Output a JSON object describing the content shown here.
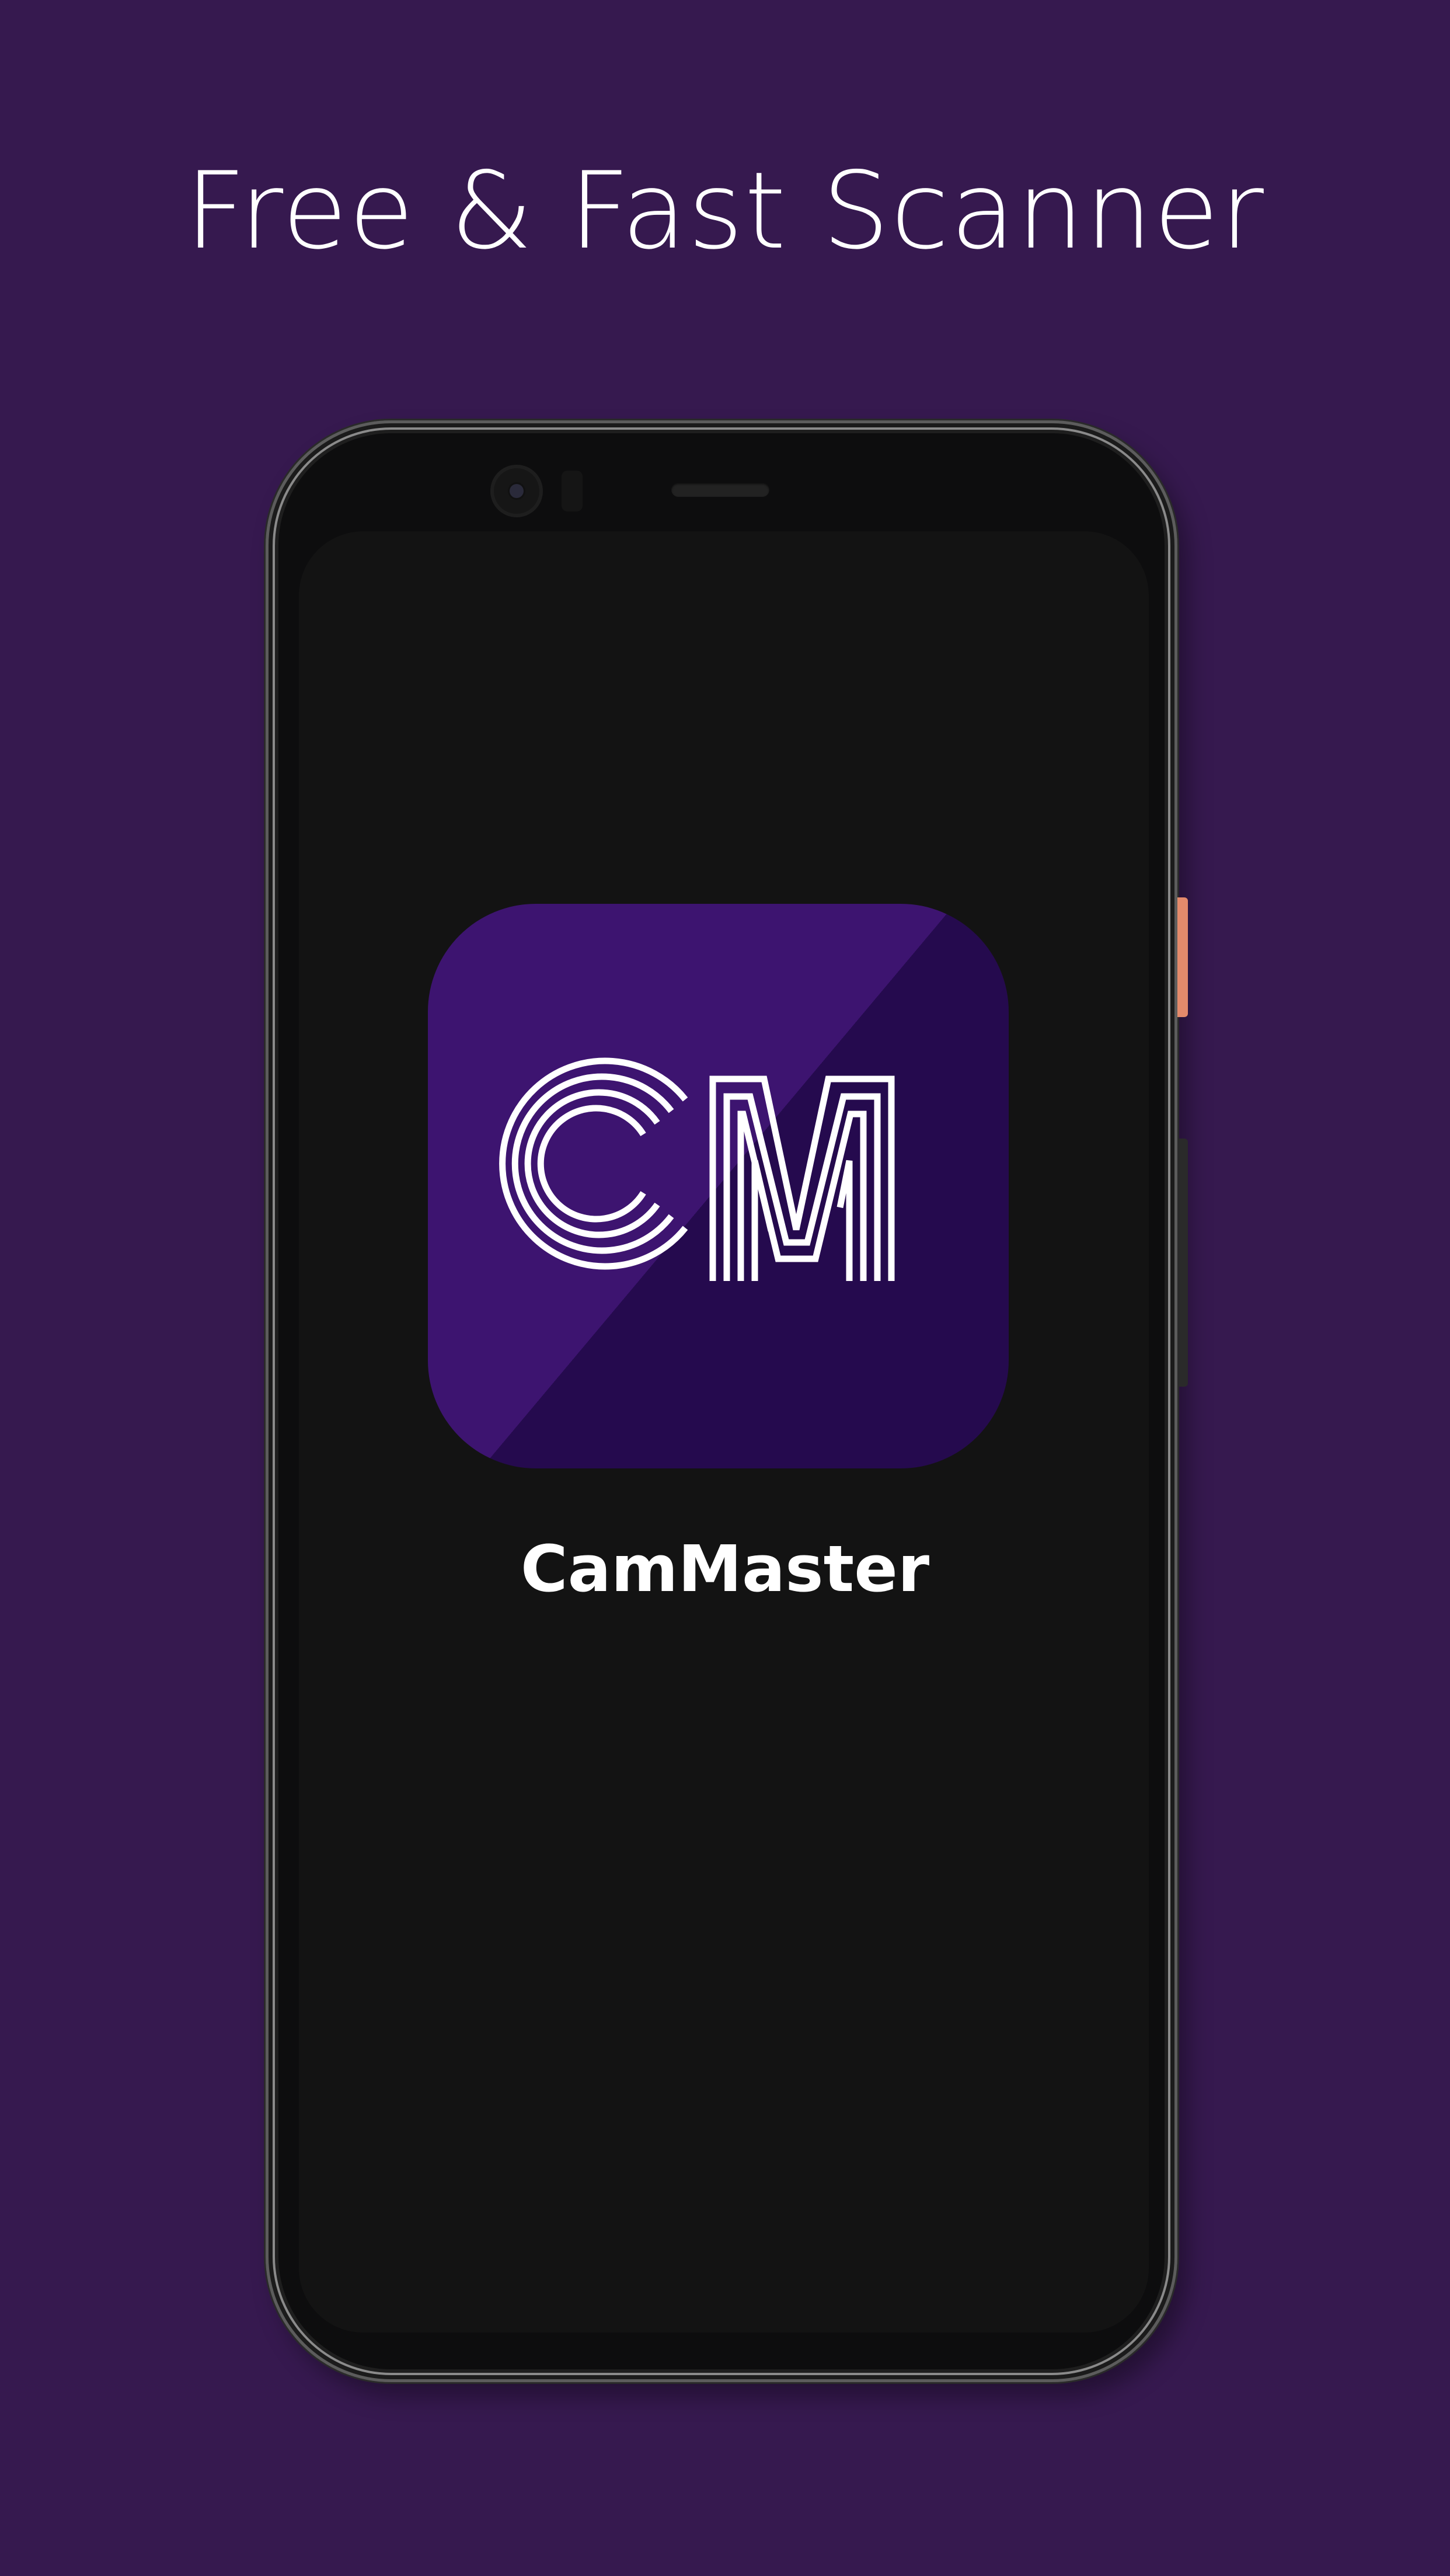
{
  "headline": "Free & Fast Scanner",
  "app": {
    "name": "CamMaster",
    "logo_text": "CM"
  },
  "colors": {
    "background": "#36194f",
    "icon_light": "#3d1470",
    "icon_dark": "#250a4e",
    "power_button": "#e48a6b",
    "screen": "#131313"
  },
  "icons": [
    "phone-front-camera",
    "phone-speaker",
    "cammaster-logo"
  ]
}
